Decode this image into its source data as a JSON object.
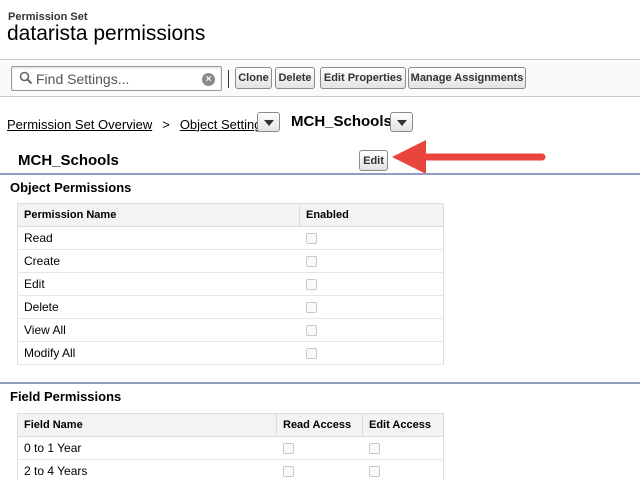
{
  "header": {
    "label": "Permission Set",
    "title": "datarista permissions"
  },
  "toolbar": {
    "search_placeholder": "Find Settings...",
    "clone_label": "Clone",
    "delete_label": "Delete",
    "edit_properties_label": "Edit Properties",
    "manage_assignments_label": "Manage Assignments"
  },
  "breadcrumb": {
    "overview": "Permission Set Overview",
    "separator": ">",
    "object_settings": "Object Settings",
    "current": "MCH_Schools"
  },
  "section": {
    "title": "MCH_Schools",
    "edit_label": "Edit"
  },
  "object_permissions": {
    "heading": "Object Permissions",
    "columns": [
      "Permission Name",
      "Enabled"
    ],
    "rows": [
      {
        "name": "Read",
        "enabled": false
      },
      {
        "name": "Create",
        "enabled": false
      },
      {
        "name": "Edit",
        "enabled": false
      },
      {
        "name": "Delete",
        "enabled": false
      },
      {
        "name": "View All",
        "enabled": false
      },
      {
        "name": "Modify All",
        "enabled": false
      }
    ]
  },
  "field_permissions": {
    "heading": "Field Permissions",
    "columns": [
      "Field Name",
      "Read Access",
      "Edit Access"
    ],
    "rows": [
      {
        "name": "0 to 1 Year",
        "read": false,
        "edit": false
      },
      {
        "name": "2 to 4 Years",
        "read": false,
        "edit": false
      }
    ]
  },
  "colors": {
    "accent_rule": "#8e9dc0",
    "arrow": "#e8453c"
  }
}
